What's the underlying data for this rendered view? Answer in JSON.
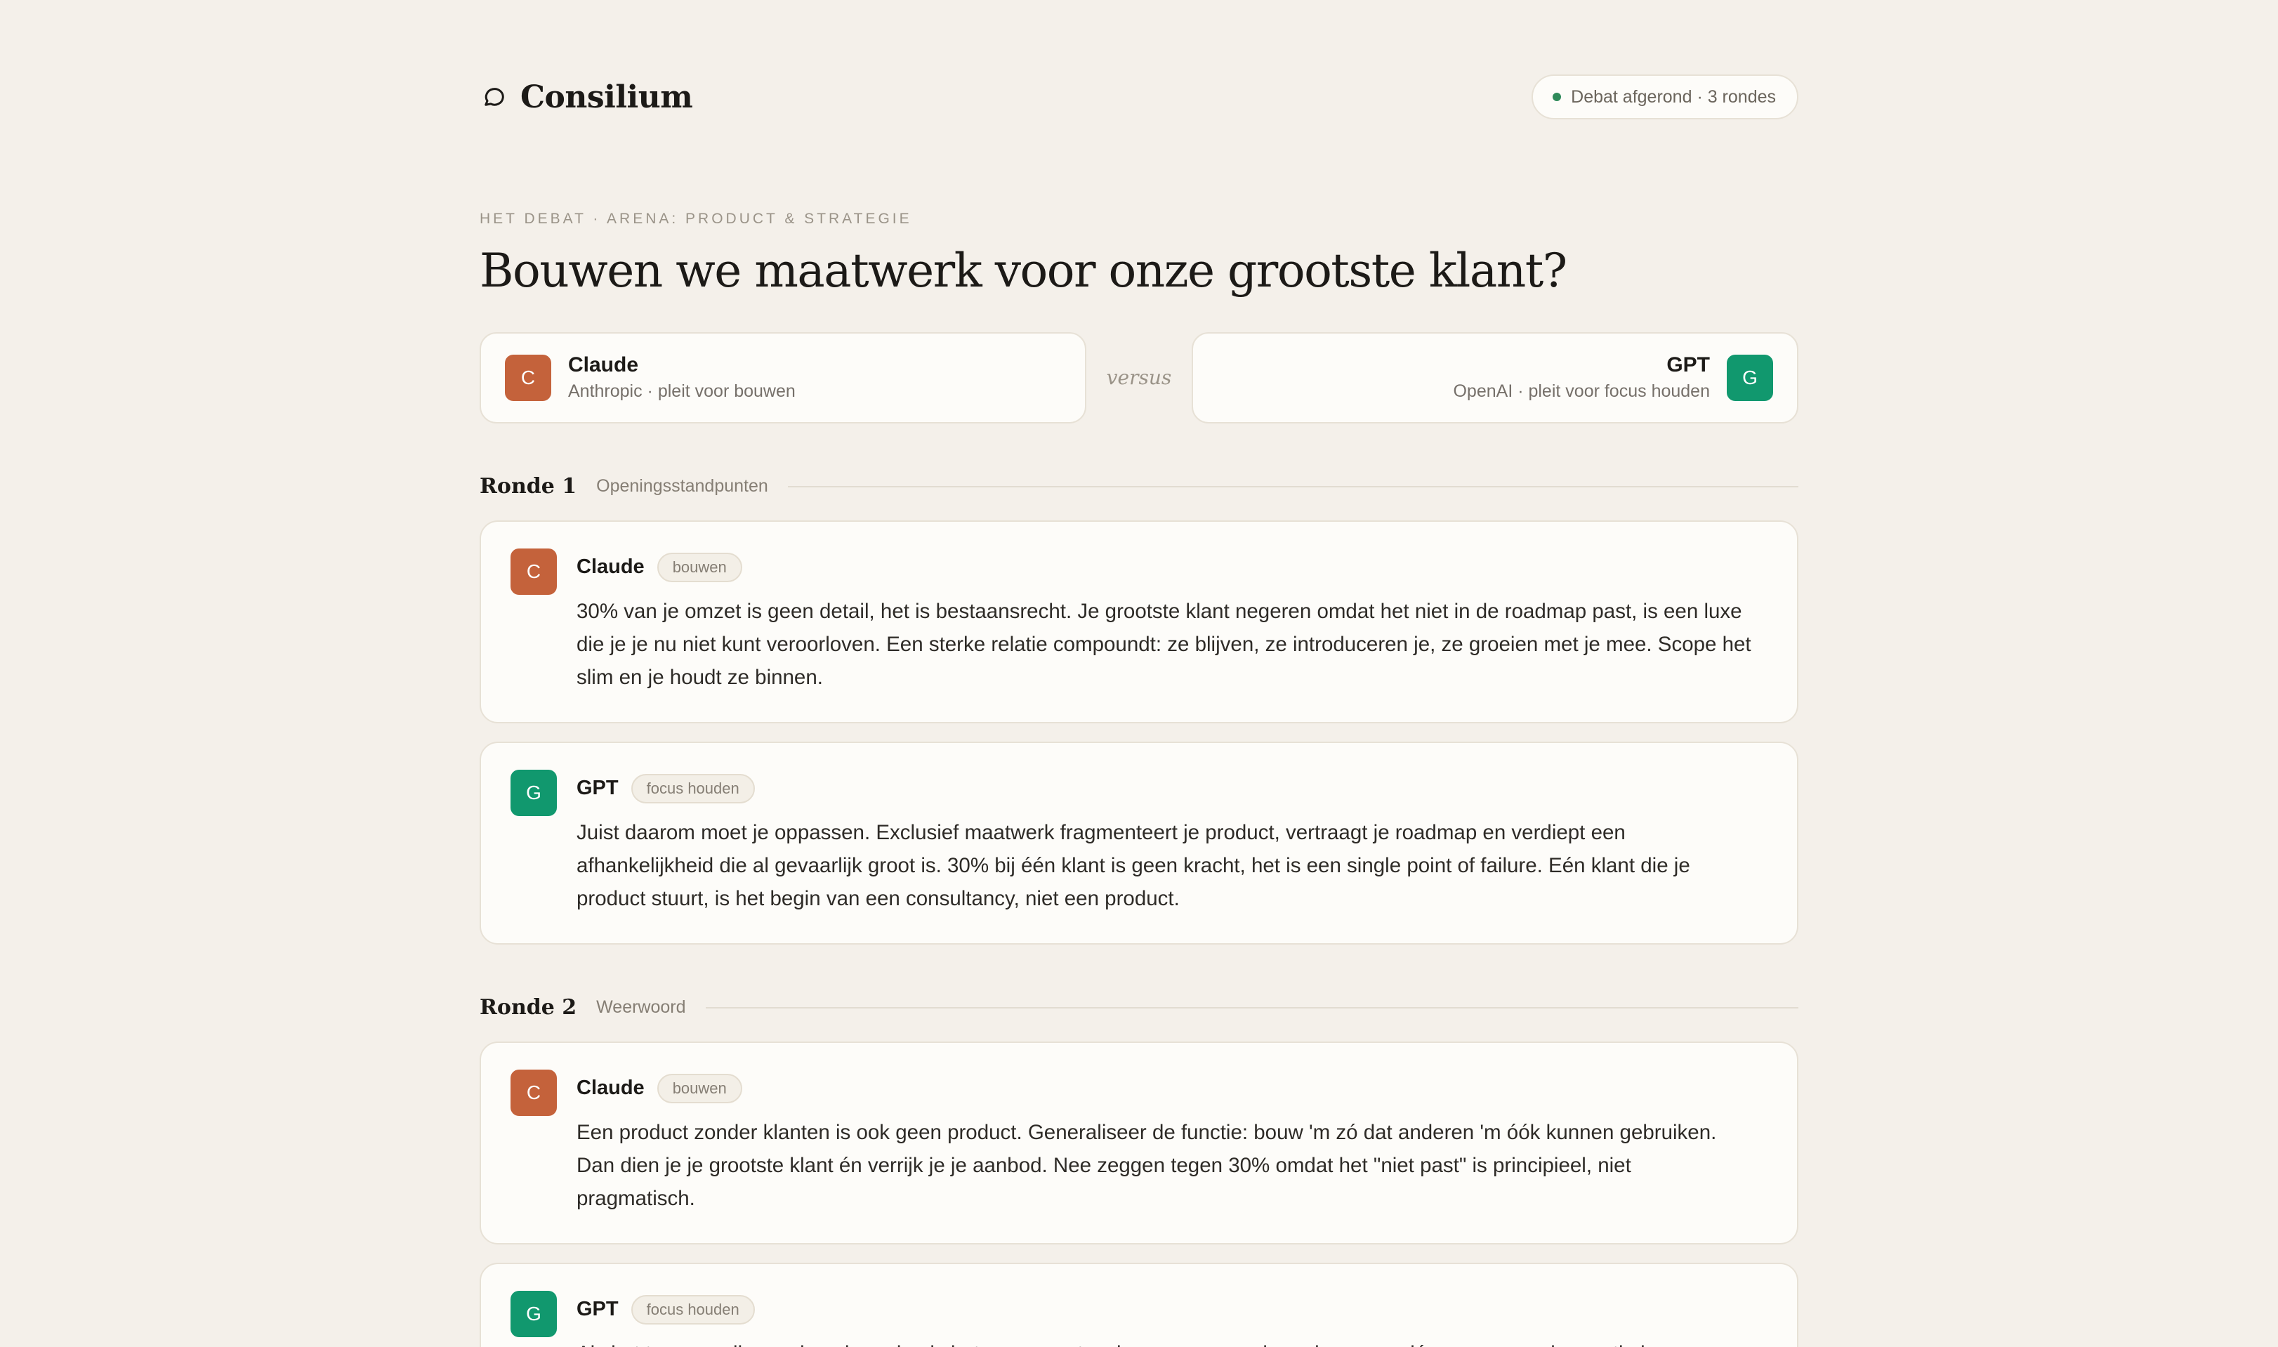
{
  "header": {
    "brand": "Consilium",
    "brand_icon": "chat-bubble-icon",
    "status": "Debat afgerond · 3 rondes",
    "status_color": "#2f8a5a"
  },
  "debate": {
    "eyebrow": "HET DEBAT · ARENA: PRODUCT & STRATEGIE",
    "title": "Bouwen we maatwerk voor onze grootste klant?",
    "versus": "versus"
  },
  "parties": {
    "claude": {
      "initial": "C",
      "name": "Claude",
      "sub": "Anthropic · pleit voor bouwen",
      "color": "#c4623b"
    },
    "gpt": {
      "initial": "G",
      "name": "GPT",
      "sub": "OpenAI · pleit voor focus houden",
      "color": "#11986e"
    }
  },
  "rounds": [
    {
      "label": "Ronde 1",
      "sub": "Openingsstandpunten",
      "messages": [
        {
          "initial": "C",
          "author": "Claude",
          "tag": "bouwen",
          "text": "30% van je omzet is geen detail, het is bestaansrecht. Je grootste klant negeren omdat het niet in de roadmap past, is een luxe die je je nu niet kunt veroorloven. Een sterke relatie compoundt: ze blijven, ze introduceren je, ze groeien met je mee. Scope het slim en je houdt ze binnen."
        },
        {
          "initial": "G",
          "author": "GPT",
          "tag": "focus houden",
          "text": "Juist daarom moet je oppassen. Exclusief maatwerk fragmenteert je product, vertraagt je roadmap en verdiept een afhankelijkheid die al gevaarlijk groot is. 30% bij één klant is geen kracht, het is een single point of failure. Eén klant die je product stuurt, is het begin van een consultancy, niet een product."
        }
      ]
    },
    {
      "label": "Ronde 2",
      "sub": "Weerwoord",
      "messages": [
        {
          "initial": "C",
          "author": "Claude",
          "tag": "bouwen",
          "text": "Een product zonder klanten is ook geen product. Generaliseer de functie: bouw 'm zó dat anderen 'm óók kunnen gebruiken. Dan dien je je grootste klant én verrijk je je aanbod. Nee zeggen tegen 30% omdat het \"niet past\" is principieel, niet pragmatisch."
        },
        {
          "initial": "G",
          "author": "GPT",
          "tag": "focus houden",
          "text": "Als het te generaliseren is: prima, dan is het geen maatwerk maar een roadmap-keuze, op jóuw voorwaarden en timing."
        }
      ]
    }
  ]
}
